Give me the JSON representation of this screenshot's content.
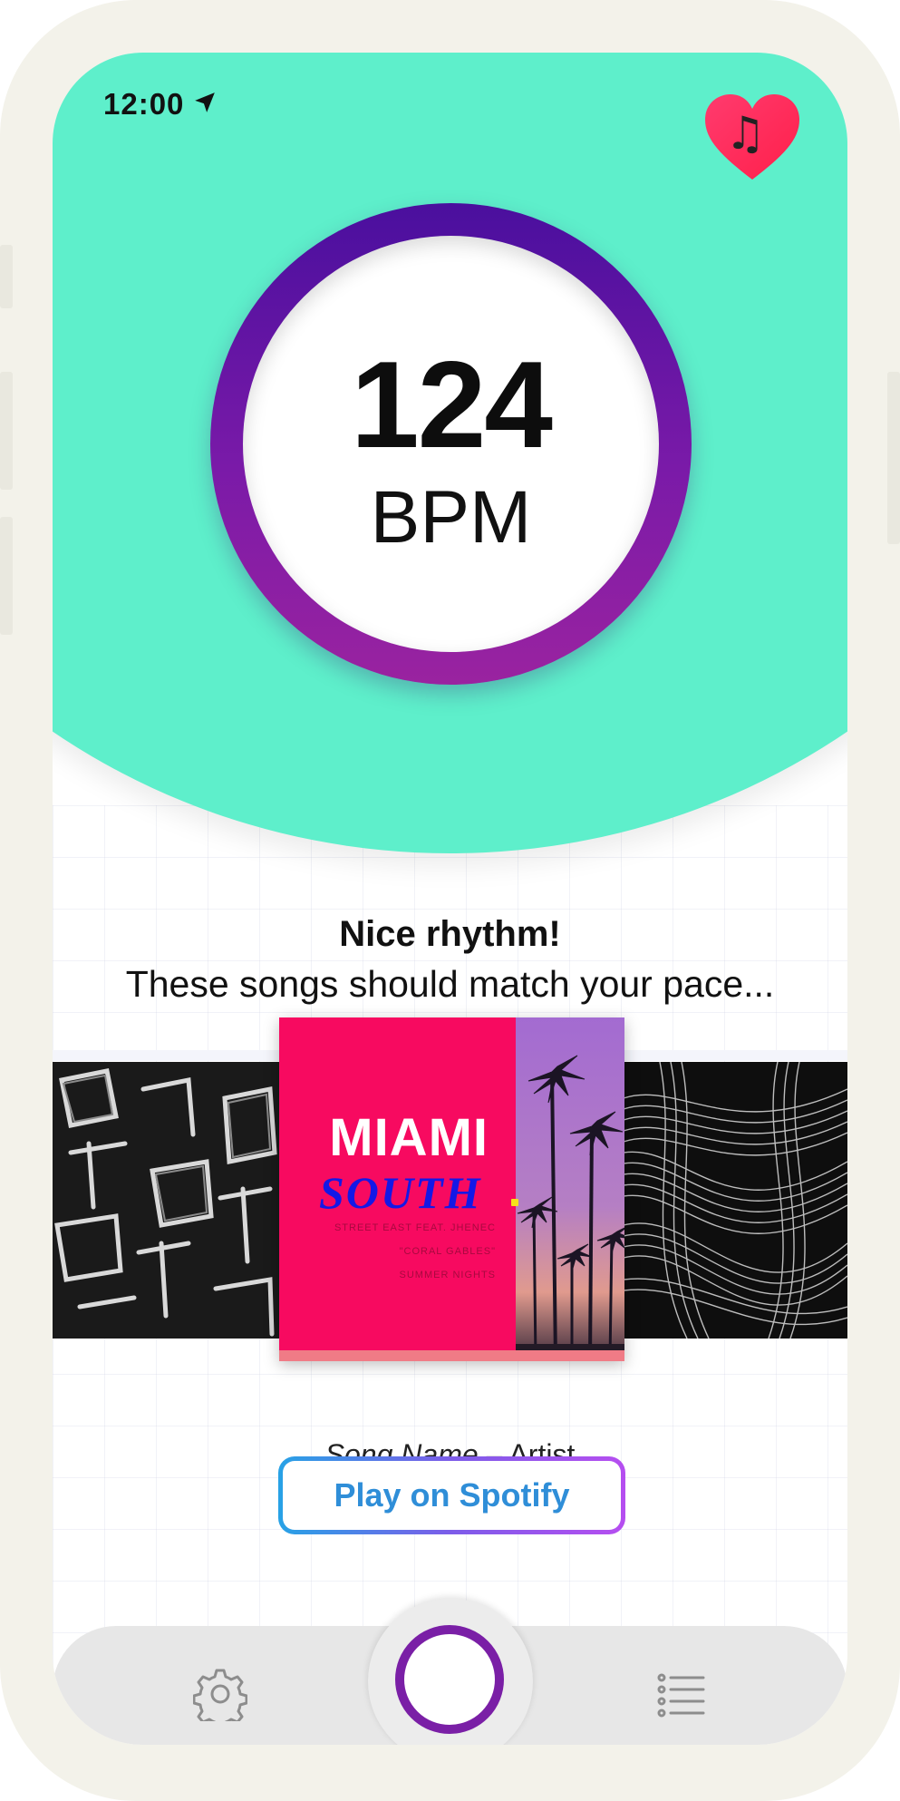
{
  "status_bar": {
    "time": "12:00"
  },
  "badge": {
    "icon": "heart-music-icon",
    "glyph": "♫"
  },
  "tempo": {
    "value": "124",
    "unit": "BPM"
  },
  "message": {
    "headline": "Nice rhythm!",
    "subline": "These songs should match your pace..."
  },
  "album": {
    "title_line1": "MIAMI",
    "title_line2": "SOUTH",
    "credits": [
      "STREET EAST FEAT. JHENEC",
      "\"CORAL GABLES\"",
      "SUMMER NIGHTS"
    ]
  },
  "song": {
    "name": "Song Name",
    "separator": " – ",
    "artist": "Artist"
  },
  "actions": {
    "spotify_label": "Play on Spotify"
  },
  "tab_bar": {
    "left_icon": "gear-icon",
    "center_icon": "record-button",
    "right_icon": "list-icon"
  },
  "colors": {
    "hero": "#5eefcb",
    "ring_top": "#4a0f9e",
    "ring_bottom": "#9a23a0",
    "album_pink": "#f70a60",
    "spotify_text": "#2f8ed8"
  }
}
